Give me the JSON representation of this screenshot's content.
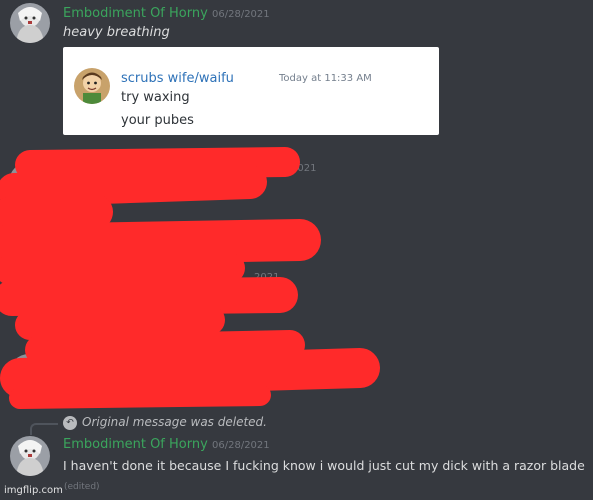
{
  "messages": {
    "first": {
      "username": "Embodiment Of Horny",
      "timestamp": "06/28/2021",
      "text": "heavy breathing"
    },
    "embed": {
      "username": "scrubs wife/waifu",
      "timestamp": "Today at 11:33 AM",
      "line1": "try waxing",
      "line2": "your pubes"
    },
    "redacted": {
      "timestamp_fragment_1": "2021",
      "timestamp_fragment_2": "2021"
    },
    "reply": {
      "deleted_notice": "Original message was deleted."
    },
    "last": {
      "username": "Embodiment Of Horny",
      "timestamp": "06/28/2021",
      "text": "I haven't done it because I fucking know i would just cut my dick with a razor blade",
      "edited_label": "(edited)"
    }
  },
  "watermark": "imgflip.com",
  "colors": {
    "background": "#36393f",
    "username": "#3ba55d",
    "embed_username": "#2e72b8",
    "redaction": "#ff2a2a"
  },
  "icons": {
    "reply": "reply-arrow-icon"
  }
}
